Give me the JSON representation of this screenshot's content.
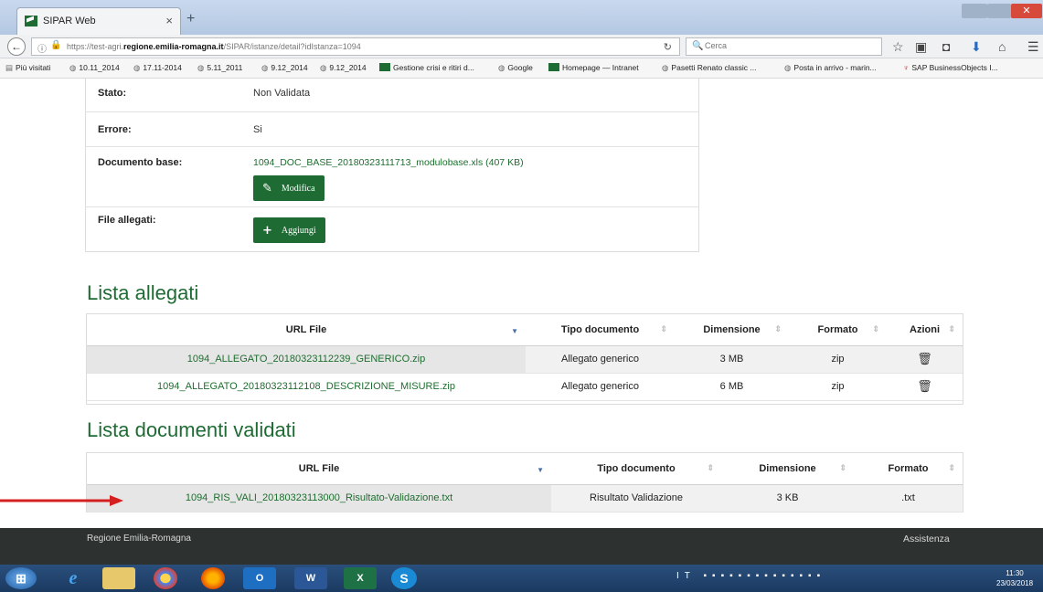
{
  "browser": {
    "tab_title": "SIPAR Web",
    "tab_close": "×",
    "new_tab": "+",
    "url_prefix": "https://test-agri.",
    "url_domain": "regione.emilia-romagna.it",
    "url_suffix": "/SIPAR/istanze/detail?idIstanza=1094",
    "search_placeholder": "Cerca",
    "bookmarks": [
      "Più visitati",
      "10.11_2014",
      "17.11-2014",
      "5.11_2011",
      "9.12_2014",
      "9.12_2014",
      "Gestione crisi e ritiri d...",
      "Google",
      "Homepage — Intranet",
      "Pasetti Renato classic ...",
      "Posta in arrivo - marin...",
      "SAP BusinessObjects I..."
    ]
  },
  "detail": {
    "stato_label": "Stato:",
    "stato_value": "Non Validata",
    "errore_label": "Errore:",
    "errore_value": "Si",
    "documento_label": "Documento base:",
    "documento_link": "1094_DOC_BASE_20180323111713_modulobase.xls (407 KB)",
    "modifica_label": "Modifica",
    "file_label": "File allegati:",
    "aggiungi_label": "Aggiungi"
  },
  "allegati": {
    "title": "Lista allegati",
    "headers": [
      "URL File",
      "Tipo documento",
      "Dimensione",
      "Formato",
      "Azioni"
    ],
    "rows": [
      {
        "url": "1094_ALLEGATO_20180323112239_GENERICO.zip",
        "tipo": "Allegato generico",
        "dim": "3 MB",
        "formato": "zip"
      },
      {
        "url": "1094_ALLEGATO_20180323112108_DESCRIZIONE_MISURE.zip",
        "tipo": "Allegato generico",
        "dim": "6 MB",
        "formato": "zip"
      }
    ]
  },
  "validati": {
    "title": "Lista documenti validati",
    "headers": [
      "URL File",
      "Tipo documento",
      "Dimensione",
      "Formato"
    ],
    "rows": [
      {
        "url": "1094_RIS_VALI_20180323113000_Risultato-Validazione.txt",
        "tipo": "Risultato Validazione",
        "dim": "3 KB",
        "formato": ".txt"
      }
    ]
  },
  "footer": {
    "left": "Regione Emilia-Romagna",
    "right": "Assistenza"
  },
  "taskbar": {
    "lang": "IT",
    "time": "11:30",
    "date": "23/03/2018"
  },
  "colors": {
    "brand_green": "#1f6b34",
    "annotation_arrow": "#d42020"
  }
}
